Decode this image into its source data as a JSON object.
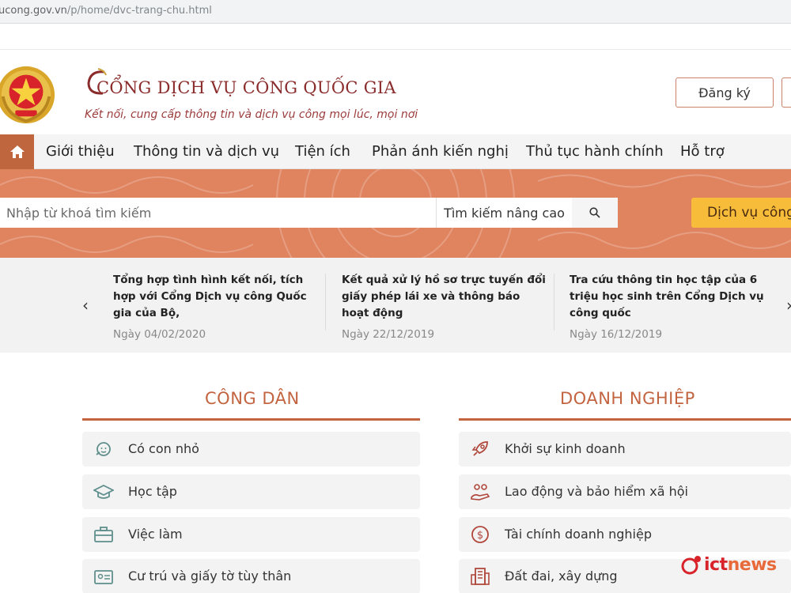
{
  "browser": {
    "url_main": "ucong.gov.vn",
    "url_path": "/p/home/dvc-trang-chu.html"
  },
  "header": {
    "title": "CỔNG DỊCH VỤ CÔNG QUỐC GIA",
    "slogan": "Kết nối, cung cấp thông tin và dịch vụ công mọi lúc, mọi nơi",
    "register_label": "Đăng ký"
  },
  "nav": {
    "home_icon": "home-icon",
    "items": [
      "Giới thiệu",
      "Thông tin và dịch vụ",
      "Tiện ích",
      "Phản ánh kiến nghị",
      "Thủ tục hành chính",
      "Hỗ trợ"
    ]
  },
  "search": {
    "placeholder": "Nhập từ khoá tìm kiếm",
    "advanced_label": "Tìm kiếm nâng cao",
    "service_label": "Dịch vụ công"
  },
  "news": [
    {
      "title": "Tổng hợp tình hình kết nối, tích hợp với Cổng Dịch vụ công Quốc gia của Bộ,",
      "date": "Ngày 04/02/2020"
    },
    {
      "title": "Kết quả xử lý hồ sơ trực tuyến đổi giấy phép lái xe và thông báo hoạt động",
      "date": "Ngày 22/12/2019"
    },
    {
      "title": "Tra cứu thông tin học tập của 6 triệu học sinh trên Cổng Dịch vụ công quốc",
      "date": "Ngày 16/12/2019"
    }
  ],
  "citizen": {
    "title": "CÔNG DÂN",
    "items": [
      {
        "label": "Có con nhỏ",
        "icon": "baby-icon"
      },
      {
        "label": "Học tập",
        "icon": "graduation-cap-icon"
      },
      {
        "label": "Việc làm",
        "icon": "briefcase-icon"
      },
      {
        "label": "Cư trú và giấy tờ tùy thân",
        "icon": "id-card-icon"
      }
    ]
  },
  "business": {
    "title": "DOANH NGHIỆP",
    "items": [
      {
        "label": "Khởi sự kinh doanh",
        "icon": "rocket-icon"
      },
      {
        "label": "Lao động và bảo hiểm xã hội",
        "icon": "people-hand-icon"
      },
      {
        "label": "Tài chính doanh nghiệp",
        "icon": "dollar-icon"
      },
      {
        "label": "Đất đai, xây dựng",
        "icon": "building-icon"
      }
    ]
  },
  "watermark": {
    "part1": "ict",
    "part2": "news"
  },
  "colors": {
    "accent": "#c0663f",
    "band": "#e0835f",
    "service": "#f7bd3a",
    "title": "#8b2c2c"
  }
}
